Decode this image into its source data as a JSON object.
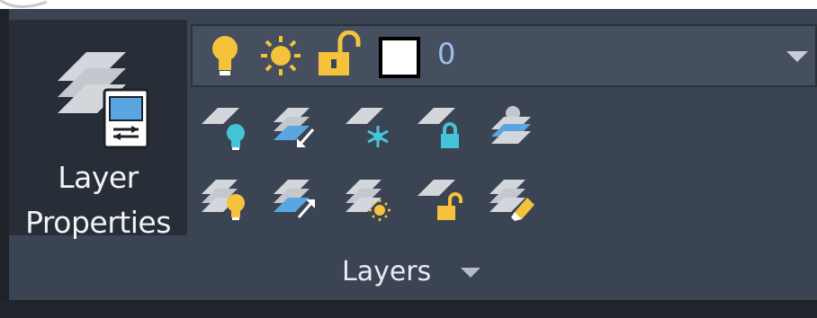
{
  "layer_properties": {
    "label_line1": "Layer",
    "label_line2": "Properties"
  },
  "layer_combo": {
    "current_layer": "0",
    "state_icons": [
      "bulb-on-icon",
      "sun-icon",
      "lock-open-icon",
      "color-swatch-icon"
    ],
    "swatch_color": "#ffffff"
  },
  "tool_rows": [
    [
      "layer-isolate-icon",
      "layer-match-icon",
      "layer-freeze-icon",
      "layer-lock-icon",
      "layer-make-current-icon"
    ],
    [
      "layer-turn-on-all-icon",
      "layer-previous-icon",
      "layer-thaw-all-icon",
      "layer-unlock-icon",
      "layer-merge-icon"
    ]
  ],
  "group": {
    "label": "Layers"
  },
  "colors": {
    "panel_bg": "#3b4453",
    "button_bg": "#272e38",
    "accent_cyan": "#45c3d9",
    "accent_yellow": "#f5c23c",
    "accent_blue": "#5aa6e0"
  }
}
